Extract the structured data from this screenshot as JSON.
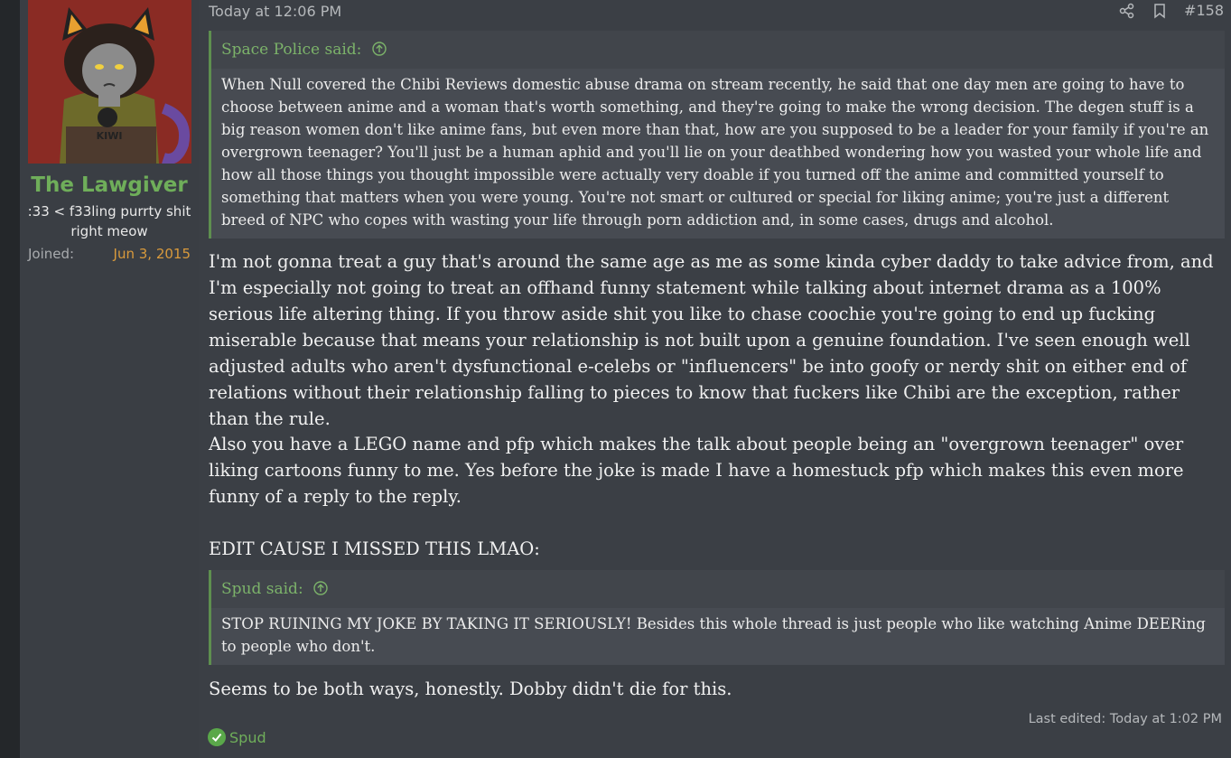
{
  "user": {
    "name": "The Lawgiver",
    "title": ":33 < f33ling purrty shit right meow",
    "joined_label": "Joined:",
    "joined_value": "Jun 3, 2015",
    "avatar_shirt_text": "KIWI"
  },
  "post": {
    "timestamp": "Today at 12:06 PM",
    "number": "#158",
    "actions": [
      "share-icon",
      "bookmark-icon"
    ],
    "quote1": {
      "author": "Space Police said:",
      "text": "When Null covered the Chibi Reviews domestic abuse drama on stream recently, he said that one day men are going to have to choose between anime and a woman that's worth something, and they're going to make the wrong decision. The degen stuff is a big reason women don't like anime fans, but even more than that, how are you supposed to be a leader for your family if you're an overgrown teenager? You'll just be a human aphid and you'll lie on your deathbed wondering how you wasted your whole life and how all those things you thought impossible were actually very doable if you turned off the anime and committed yourself to something that matters when you were young. You're not smart or cultured or special for liking anime; you're just a different breed of NPC who copes with wasting your life through porn addiction and, in some cases, drugs and alcohol."
    },
    "para1": "I'm not gonna treat a guy that's around the same age as me as some kinda cyber daddy to take advice from, and I'm especially not going to treat an offhand funny statement while talking about internet drama as a 100% serious life altering thing. If you throw aside shit you like to chase coochie you're going to end up fucking miserable because that means your relationship is not built upon a genuine foundation. I've seen enough well adjusted adults who aren't dysfunctional e-celebs or \"influencers\" be into goofy or nerdy shit on either end of relations without their relationship falling to pieces to know that fuckers like Chibi are the exception, rather than the rule.",
    "para2": "Also you have a LEGO name and pfp which makes the talk about people being an \"overgrown teenager\" over liking cartoons funny to me. Yes before the joke is made I have a homestuck pfp which makes this even more funny of a reply to the reply.",
    "para3": "EDIT CAUSE I MISSED THIS LMAO:",
    "quote2": {
      "author": "Spud said:",
      "text": "STOP RUINING MY JOKE BY TAKING IT SERIOUSLY! Besides this whole thread is just people who like watching Anime DEERing to people who don't."
    },
    "para4": "Seems to be both ways, honestly. Dobby didn't die for this.",
    "last_edited": "Last edited: Today at 1:02 PM",
    "reaction_user": "Spud"
  },
  "colors": {
    "username": "#6fae5a",
    "joined_value": "#d99a3c",
    "quote_border": "#5e8f4f",
    "quote_author": "#7cb36a"
  }
}
